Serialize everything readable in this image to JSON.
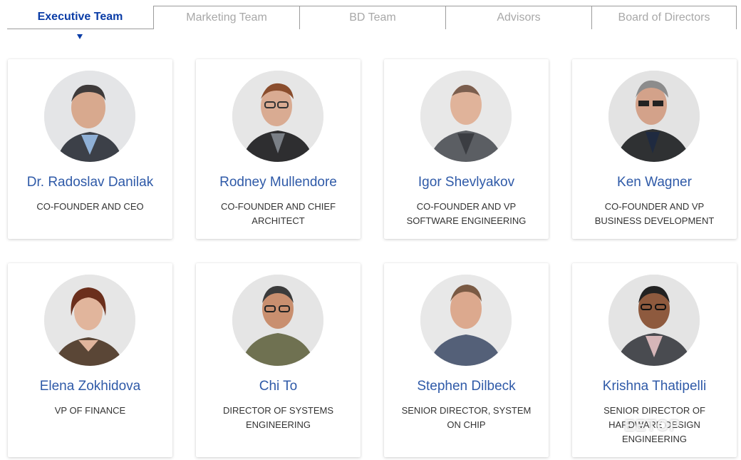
{
  "tabs": [
    {
      "label": "Executive Team",
      "active": true
    },
    {
      "label": "Marketing Team",
      "active": false
    },
    {
      "label": "BD Team",
      "active": false
    },
    {
      "label": "Advisors",
      "active": false
    },
    {
      "label": "Board of Directors",
      "active": false
    }
  ],
  "team": [
    {
      "name": "Dr. Radoslav Danilak",
      "role": "CO-FOUNDER AND CEO"
    },
    {
      "name": "Rodney Mullendore",
      "role": "CO-FOUNDER AND CHIEF ARCHITECT"
    },
    {
      "name": "Igor Shevlyakov",
      "role": "CO-FOUNDER AND VP SOFTWARE ENGINEERING"
    },
    {
      "name": "Ken Wagner",
      "role": "CO-FOUNDER AND VP BUSINESS DEVELOPMENT"
    },
    {
      "name": "Elena Zokhidova",
      "role": "VP OF FINANCE"
    },
    {
      "name": "Chi To",
      "role": "DIRECTOR OF SYSTEMS ENGINEERING"
    },
    {
      "name": "Stephen Dilbeck",
      "role": "SENIOR DIRECTOR, SYSTEM ON CHIP"
    },
    {
      "name": "Krishna Thatipelli",
      "role": "SENIOR DIRECTOR OF HARDWARE DESIGN ENGINEERING"
    }
  ],
  "watermark": "EETOP",
  "colors": {
    "accent": "#0a3ca6",
    "name": "#2f5aa8",
    "inactive_tab": "#a8a8a8"
  }
}
